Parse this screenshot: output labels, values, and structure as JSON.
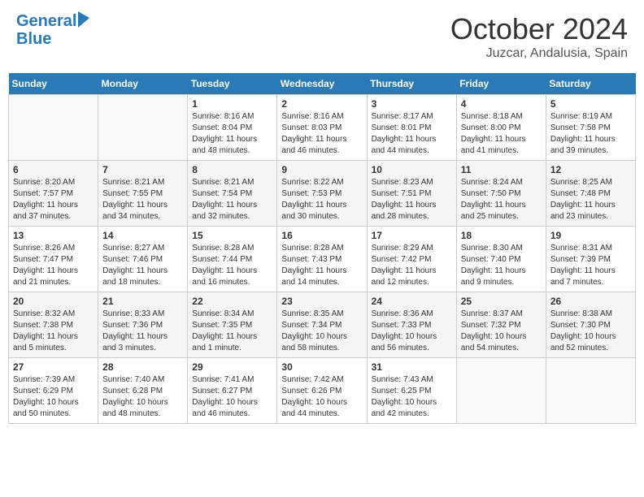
{
  "header": {
    "logo_line1": "General",
    "logo_line2": "Blue",
    "month": "October 2024",
    "location": "Juzcar, Andalusia, Spain"
  },
  "weekdays": [
    "Sunday",
    "Monday",
    "Tuesday",
    "Wednesday",
    "Thursday",
    "Friday",
    "Saturday"
  ],
  "weeks": [
    [
      null,
      null,
      {
        "day": "1",
        "sunrise": "Sunrise: 8:16 AM",
        "sunset": "Sunset: 8:04 PM",
        "daylight": "Daylight: 11 hours and 48 minutes."
      },
      {
        "day": "2",
        "sunrise": "Sunrise: 8:16 AM",
        "sunset": "Sunset: 8:03 PM",
        "daylight": "Daylight: 11 hours and 46 minutes."
      },
      {
        "day": "3",
        "sunrise": "Sunrise: 8:17 AM",
        "sunset": "Sunset: 8:01 PM",
        "daylight": "Daylight: 11 hours and 44 minutes."
      },
      {
        "day": "4",
        "sunrise": "Sunrise: 8:18 AM",
        "sunset": "Sunset: 8:00 PM",
        "daylight": "Daylight: 11 hours and 41 minutes."
      },
      {
        "day": "5",
        "sunrise": "Sunrise: 8:19 AM",
        "sunset": "Sunset: 7:58 PM",
        "daylight": "Daylight: 11 hours and 39 minutes."
      }
    ],
    [
      {
        "day": "6",
        "sunrise": "Sunrise: 8:20 AM",
        "sunset": "Sunset: 7:57 PM",
        "daylight": "Daylight: 11 hours and 37 minutes."
      },
      {
        "day": "7",
        "sunrise": "Sunrise: 8:21 AM",
        "sunset": "Sunset: 7:55 PM",
        "daylight": "Daylight: 11 hours and 34 minutes."
      },
      {
        "day": "8",
        "sunrise": "Sunrise: 8:21 AM",
        "sunset": "Sunset: 7:54 PM",
        "daylight": "Daylight: 11 hours and 32 minutes."
      },
      {
        "day": "9",
        "sunrise": "Sunrise: 8:22 AM",
        "sunset": "Sunset: 7:53 PM",
        "daylight": "Daylight: 11 hours and 30 minutes."
      },
      {
        "day": "10",
        "sunrise": "Sunrise: 8:23 AM",
        "sunset": "Sunset: 7:51 PM",
        "daylight": "Daylight: 11 hours and 28 minutes."
      },
      {
        "day": "11",
        "sunrise": "Sunrise: 8:24 AM",
        "sunset": "Sunset: 7:50 PM",
        "daylight": "Daylight: 11 hours and 25 minutes."
      },
      {
        "day": "12",
        "sunrise": "Sunrise: 8:25 AM",
        "sunset": "Sunset: 7:48 PM",
        "daylight": "Daylight: 11 hours and 23 minutes."
      }
    ],
    [
      {
        "day": "13",
        "sunrise": "Sunrise: 8:26 AM",
        "sunset": "Sunset: 7:47 PM",
        "daylight": "Daylight: 11 hours and 21 minutes."
      },
      {
        "day": "14",
        "sunrise": "Sunrise: 8:27 AM",
        "sunset": "Sunset: 7:46 PM",
        "daylight": "Daylight: 11 hours and 18 minutes."
      },
      {
        "day": "15",
        "sunrise": "Sunrise: 8:28 AM",
        "sunset": "Sunset: 7:44 PM",
        "daylight": "Daylight: 11 hours and 16 minutes."
      },
      {
        "day": "16",
        "sunrise": "Sunrise: 8:28 AM",
        "sunset": "Sunset: 7:43 PM",
        "daylight": "Daylight: 11 hours and 14 minutes."
      },
      {
        "day": "17",
        "sunrise": "Sunrise: 8:29 AM",
        "sunset": "Sunset: 7:42 PM",
        "daylight": "Daylight: 11 hours and 12 minutes."
      },
      {
        "day": "18",
        "sunrise": "Sunrise: 8:30 AM",
        "sunset": "Sunset: 7:40 PM",
        "daylight": "Daylight: 11 hours and 9 minutes."
      },
      {
        "day": "19",
        "sunrise": "Sunrise: 8:31 AM",
        "sunset": "Sunset: 7:39 PM",
        "daylight": "Daylight: 11 hours and 7 minutes."
      }
    ],
    [
      {
        "day": "20",
        "sunrise": "Sunrise: 8:32 AM",
        "sunset": "Sunset: 7:38 PM",
        "daylight": "Daylight: 11 hours and 5 minutes."
      },
      {
        "day": "21",
        "sunrise": "Sunrise: 8:33 AM",
        "sunset": "Sunset: 7:36 PM",
        "daylight": "Daylight: 11 hours and 3 minutes."
      },
      {
        "day": "22",
        "sunrise": "Sunrise: 8:34 AM",
        "sunset": "Sunset: 7:35 PM",
        "daylight": "Daylight: 11 hours and 1 minute."
      },
      {
        "day": "23",
        "sunrise": "Sunrise: 8:35 AM",
        "sunset": "Sunset: 7:34 PM",
        "daylight": "Daylight: 10 hours and 58 minutes."
      },
      {
        "day": "24",
        "sunrise": "Sunrise: 8:36 AM",
        "sunset": "Sunset: 7:33 PM",
        "daylight": "Daylight: 10 hours and 56 minutes."
      },
      {
        "day": "25",
        "sunrise": "Sunrise: 8:37 AM",
        "sunset": "Sunset: 7:32 PM",
        "daylight": "Daylight: 10 hours and 54 minutes."
      },
      {
        "day": "26",
        "sunrise": "Sunrise: 8:38 AM",
        "sunset": "Sunset: 7:30 PM",
        "daylight": "Daylight: 10 hours and 52 minutes."
      }
    ],
    [
      {
        "day": "27",
        "sunrise": "Sunrise: 7:39 AM",
        "sunset": "Sunset: 6:29 PM",
        "daylight": "Daylight: 10 hours and 50 minutes."
      },
      {
        "day": "28",
        "sunrise": "Sunrise: 7:40 AM",
        "sunset": "Sunset: 6:28 PM",
        "daylight": "Daylight: 10 hours and 48 minutes."
      },
      {
        "day": "29",
        "sunrise": "Sunrise: 7:41 AM",
        "sunset": "Sunset: 6:27 PM",
        "daylight": "Daylight: 10 hours and 46 minutes."
      },
      {
        "day": "30",
        "sunrise": "Sunrise: 7:42 AM",
        "sunset": "Sunset: 6:26 PM",
        "daylight": "Daylight: 10 hours and 44 minutes."
      },
      {
        "day": "31",
        "sunrise": "Sunrise: 7:43 AM",
        "sunset": "Sunset: 6:25 PM",
        "daylight": "Daylight: 10 hours and 42 minutes."
      },
      null,
      null
    ]
  ]
}
